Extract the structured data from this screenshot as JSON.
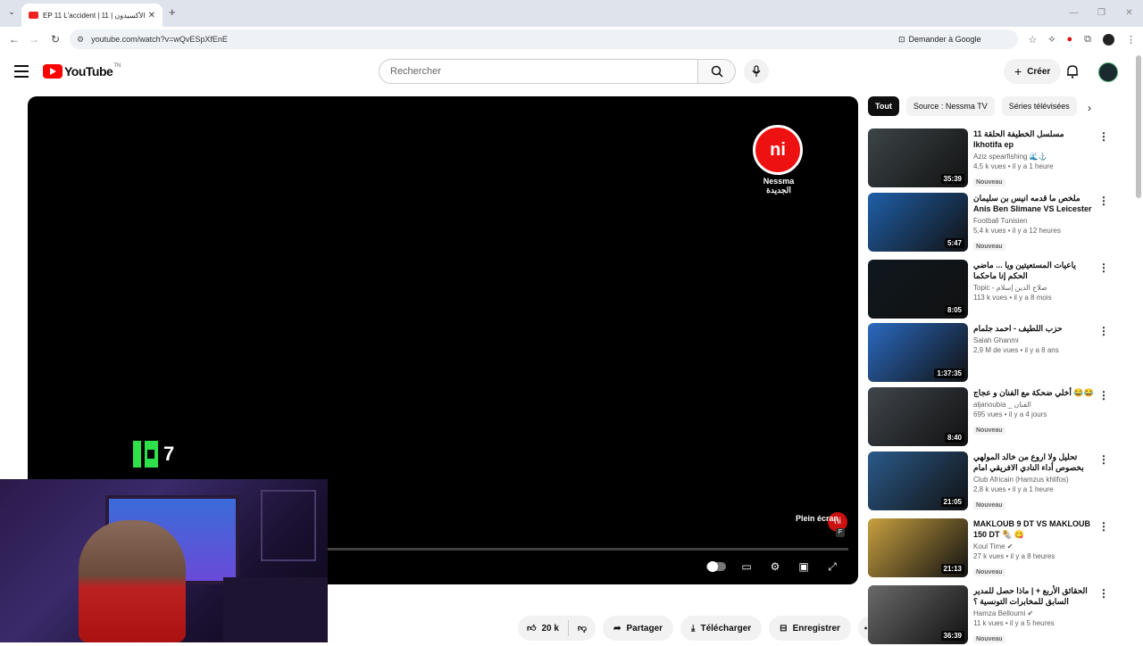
{
  "browser": {
    "tab_title": "EP 11 L'accident | الأكسيدون | 11 ...",
    "url": "youtube.com/watch?v=wQvESpXfEnE",
    "ask_google": "Demander à Google"
  },
  "youtube": {
    "logo_text": "YouTube",
    "country": "TN",
    "search_placeholder": "Rechercher",
    "create_label": "Créer"
  },
  "player": {
    "channel_logo_text": "Nessma الجديدة",
    "k7_number": "7",
    "fullscreen_hint": "Plein écran",
    "fullscreen_key": "F",
    "logo_badge": "ni"
  },
  "actions": {
    "likes": "20 k",
    "share": "Partager",
    "download": "Télécharger",
    "save": "Enregistrer"
  },
  "chips": [
    "Tout",
    "Source : Nessma TV",
    "Séries télévisées"
  ],
  "recommendations": [
    {
      "title": "مسلسل الخطيفة الحلقة 11 Ikhotifa ep",
      "channel": "Aziz spearfishing 🌊⚓",
      "meta": "4,5 k vues • il y a 1 heure",
      "badge": "Nouveau",
      "duration": "35:39",
      "color": "#3c4548"
    },
    {
      "title": "ملخص ما قدمه انيس بن سليمان Anis Ben Slimane VS Leicester City",
      "channel": "Football Tunisien",
      "meta": "5,4 k vues • il y a 12 heures",
      "badge": "Nouveau",
      "duration": "5:47",
      "color": "#1f5fa8"
    },
    {
      "title": "ياعيات المستعيتين ويا ... ماضي الحكم إنا ماحكما",
      "channel": "Topic - صلاح الدين إسلام",
      "meta": "113 k vues • il y a 8 mois",
      "badge": "",
      "duration": "8:05",
      "color": "#10181e"
    },
    {
      "title": "حزب اللطيف - احمد جلمام",
      "channel": "Salah Ghanmi",
      "meta": "2,9 M de vues • il y a 8 ans",
      "badge": "",
      "duration": "1:37:35",
      "color": "#2a6ac0"
    },
    {
      "title": "أخلي ضحكة مع الفنان و عجاج 😂😂",
      "channel": "aljanoubia _ الفنان",
      "meta": "695 vues • il y a 4 jours",
      "badge": "Nouveau",
      "duration": "8:40",
      "color": "#40464c"
    },
    {
      "title": "تحليل ولا اروع من خالد المولهي بخصوص أداء النادي الافريقي امام الملعب التونسي كلها فكر ...",
      "channel": "Club Africain (Hamzus khlifos)",
      "meta": "2,8 k vues • il y a 1 heure",
      "badge": "Nouveau",
      "duration": "21:05",
      "color": "#2a5a8a"
    },
    {
      "title": "MAKLOUB 9 DT VS MAKLOUB 150 DT 🌯 😋",
      "channel": "Koul Time ✔",
      "meta": "27 k vues • il y a 8 heures",
      "badge": "Nouveau",
      "duration": "21:13",
      "color": "#c8a040"
    },
    {
      "title": "الحقائق الأربع + | ماذا حصل للمدير السابق للمخابرات التونسية ؟",
      "channel": "Hamza Belloumi ✔",
      "meta": "11 k vues • il y a 5 heures",
      "badge": "Nouveau",
      "duration": "36:39",
      "color": "#6a6a6a"
    }
  ]
}
